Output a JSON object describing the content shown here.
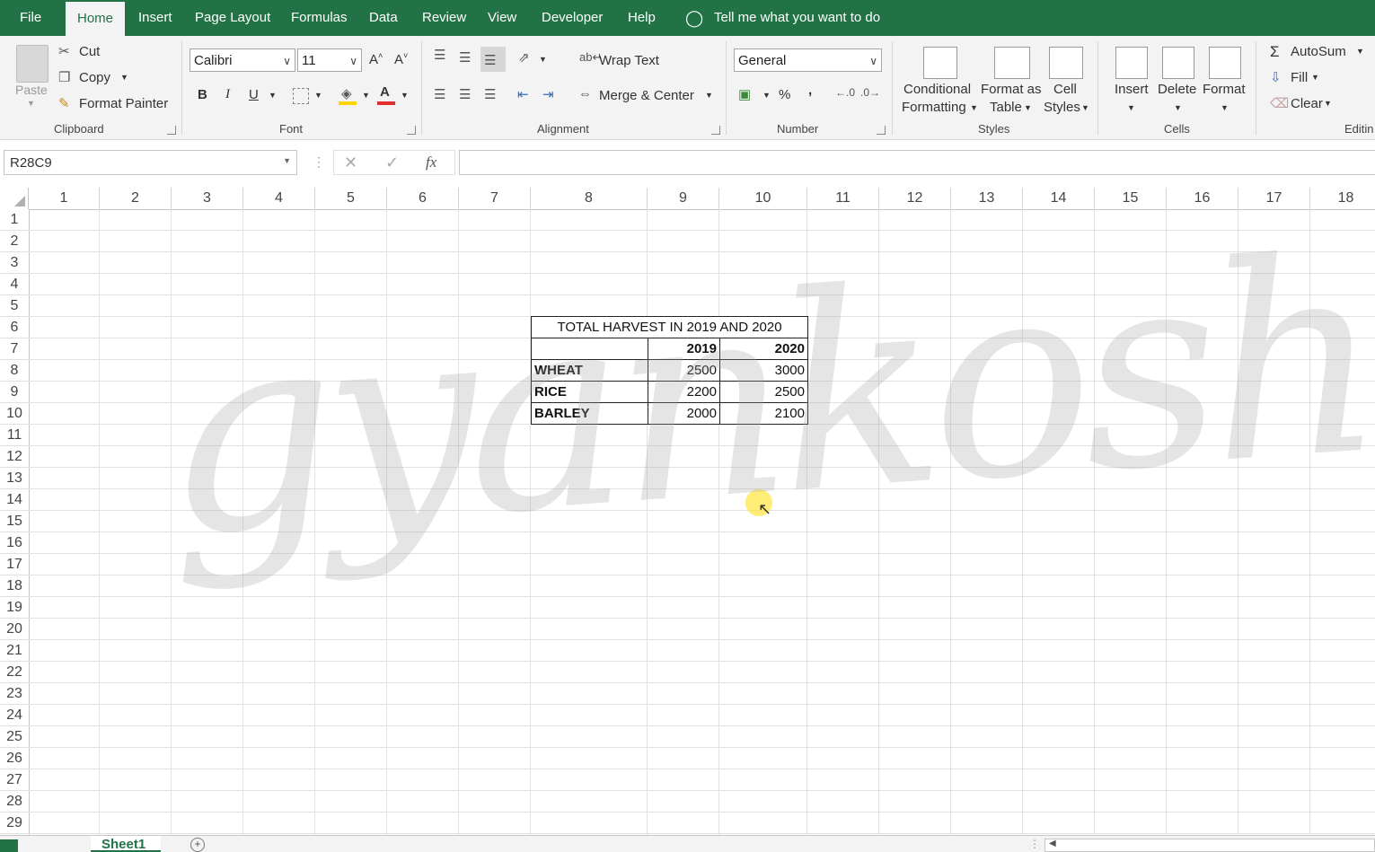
{
  "tabs": [
    {
      "label": "File",
      "active": false
    },
    {
      "label": "Home",
      "active": true
    },
    {
      "label": "Insert",
      "active": false
    },
    {
      "label": "Page Layout",
      "active": false
    },
    {
      "label": "Formulas",
      "active": false
    },
    {
      "label": "Data",
      "active": false
    },
    {
      "label": "Review",
      "active": false
    },
    {
      "label": "View",
      "active": false
    },
    {
      "label": "Developer",
      "active": false
    },
    {
      "label": "Help",
      "active": false
    }
  ],
  "tell_me": "Tell me what you want to do",
  "clipboard": {
    "paste": "Paste",
    "cut": "Cut",
    "copy": "Copy",
    "format_painter": "Format Painter",
    "group": "Clipboard"
  },
  "font": {
    "name": "Calibri",
    "size": "11",
    "bold": "B",
    "italic": "I",
    "underline": "U",
    "group": "Font",
    "font_color": "#e03030",
    "fill_color": "#ffd400"
  },
  "alignment": {
    "wrap_text": "Wrap Text",
    "merge_center": "Merge & Center",
    "group": "Alignment"
  },
  "number": {
    "format": "General",
    "percent": "%",
    "comma": ",",
    "group": "Number"
  },
  "styles": {
    "conditional_1": "Conditional",
    "conditional_2": "Formatting",
    "format_table_1": "Format as",
    "format_table_2": "Table",
    "cell_styles_1": "Cell",
    "cell_styles_2": "Styles",
    "group": "Styles"
  },
  "cells_group": {
    "insert": "Insert",
    "delete": "Delete",
    "format": "Format",
    "group": "Cells"
  },
  "editing": {
    "autosum": "AutoSum",
    "fill": "Fill",
    "clear": "Clear",
    "group": "Editin"
  },
  "name_box": "R28C9",
  "fx": "fx",
  "columns": [
    "1",
    "2",
    "3",
    "4",
    "5",
    "6",
    "7",
    "8",
    "9",
    "10",
    "11",
    "12",
    "13",
    "14",
    "15",
    "16",
    "17",
    "18"
  ],
  "rows": [
    "1",
    "2",
    "3",
    "4",
    "5",
    "6",
    "7",
    "8",
    "9",
    "10",
    "11",
    "12",
    "13",
    "14",
    "15",
    "16",
    "17",
    "18",
    "19",
    "20",
    "21",
    "22",
    "23",
    "24",
    "25",
    "26",
    "27",
    "28",
    "29"
  ],
  "table": {
    "title": "TOTAL HARVEST IN 2019 AND 2020",
    "header": [
      "",
      "2019",
      "2020"
    ],
    "rows": [
      [
        "WHEAT",
        "2500",
        "3000"
      ],
      [
        "RICE",
        "2200",
        "2500"
      ],
      [
        "BARLEY",
        "2000",
        "2100"
      ]
    ]
  },
  "watermark": "gyankosh.net",
  "sheet_tab": "Sheet1",
  "accent_color": "#217346"
}
